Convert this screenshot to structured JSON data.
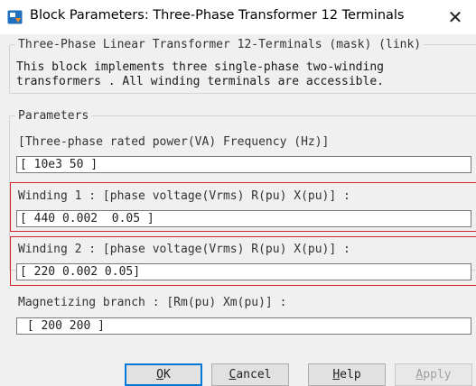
{
  "window": {
    "title": "Block Parameters: Three-Phase Transformer 12 Terminals",
    "close_glyph": "✕",
    "icon": "simulink-block-icon"
  },
  "mask": {
    "legend": "Three-Phase Linear Transformer 12-Terminals (mask) (link)",
    "description": "This block implements three single-phase two-winding\ntransformers . All winding terminals are accessible."
  },
  "parameters": {
    "legend": "Parameters",
    "rated_label": "[Three-phase rated power(VA)  Frequency (Hz)]",
    "rated_value": "[ 10e3 50 ]",
    "winding1_label": "Winding 1 : [phase voltage(Vrms)  R(pu)  X(pu)] :",
    "winding1_value": "[ 440 0.002  0.05 ]",
    "winding2_label": "Winding 2 : [phase voltage(Vrms)  R(pu)  X(pu)] :",
    "winding2_value": "[ 220 0.002 0.05]",
    "magnetizing_label": "Magnetizing branch : [Rm(pu)  Xm(pu)] :",
    "magnetizing_value": " [ 200 200 ]"
  },
  "highlight_color": "#d0262b",
  "buttons": {
    "ok_mn": "O",
    "ok_rest": "K",
    "cancel_mn": "C",
    "cancel_rest": "ancel",
    "help_mn": "H",
    "help_rest": "elp",
    "apply_mn": "A",
    "apply_rest": "pply"
  }
}
